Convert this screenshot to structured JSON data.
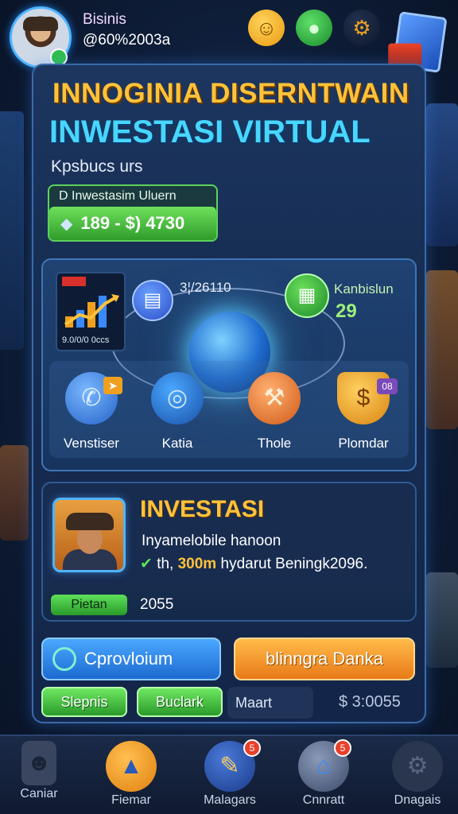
{
  "user": {
    "name": "Bisinis",
    "id": "@60%2003a"
  },
  "header": {
    "title_line1": "INNOGINIA DISERNTWAIN",
    "title_line2": "INWESTASI VIRTUAL",
    "subtitle": "Kpsbucs urs"
  },
  "investment_box": {
    "label": "D Inwestasim Uluern",
    "value": "189 - $) 4730"
  },
  "network": {
    "chart_caption": "9.0/0/0 0ccs",
    "node_value_1": "3¦/26110",
    "node_label_2": "Kanbislun",
    "node_value_2": "29",
    "features": [
      {
        "label": "Venstiser",
        "icon": "phone-icon"
      },
      {
        "label": "Katia",
        "icon": "target-icon"
      },
      {
        "label": "Thole",
        "icon": "hammer-icon"
      },
      {
        "label": "Plomdar",
        "icon": "dollar-shield-icon"
      }
    ],
    "badge_purple": "08"
  },
  "invest_card": {
    "title": "INVESTASI",
    "description": "Inyamelobile hanoon",
    "detail_prefix": "th,",
    "detail_highlight": "300m",
    "detail_suffix": "hydarut Beningk2096.",
    "status_label": "Pietan",
    "status_value": "2055"
  },
  "actions": {
    "primary": "Cprovloium",
    "secondary": "blinngra Danka",
    "green_1": "Slepnis",
    "green_2": "Buclark",
    "market_label": "Maart",
    "balance": "$ 3:0055"
  },
  "nav": {
    "items": [
      {
        "label": "Caniar",
        "icon": "profile-card-icon"
      },
      {
        "label": "Fiemar",
        "icon": "map-icon"
      },
      {
        "label": "Malagars",
        "icon": "tools-icon"
      },
      {
        "label": "Cnnratt",
        "icon": "home-icon"
      },
      {
        "label": "Dnagais",
        "icon": "gear-icon"
      }
    ],
    "badges": [
      "5",
      "5"
    ]
  },
  "colors": {
    "accent_gold": "#ffc23a",
    "accent_cyan": "#47d6ff",
    "accent_green": "#5ee05a",
    "panel_bg": "#162c50"
  }
}
